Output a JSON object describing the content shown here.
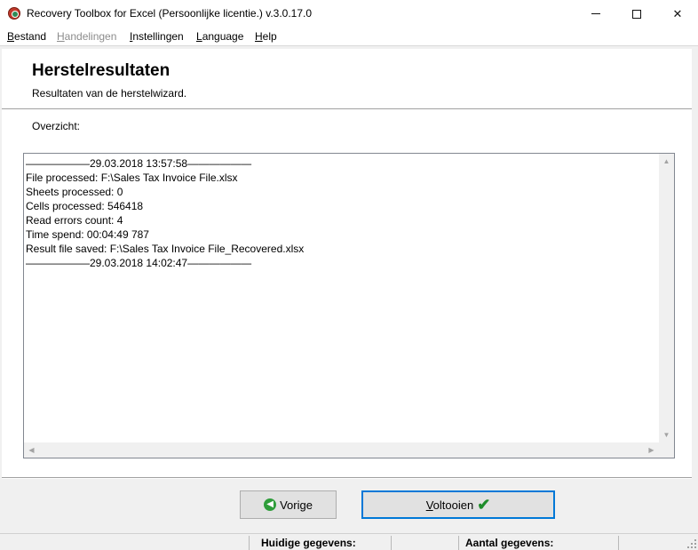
{
  "window": {
    "title": "Recovery Toolbox for Excel (Persoonlijke licentie.) v.3.0.17.0",
    "minimize_icon": "minimize-icon",
    "maximize_icon": "maximize-icon",
    "close_icon": "close-icon",
    "close_glyph": "✕"
  },
  "menu": {
    "items": [
      {
        "mnemonic": "B",
        "rest": "estand",
        "enabled": true
      },
      {
        "mnemonic": "H",
        "rest": "andelingen",
        "enabled": false
      },
      {
        "mnemonic": "I",
        "rest": "nstellingen",
        "enabled": true
      },
      {
        "mnemonic": "L",
        "rest": "anguage",
        "enabled": true
      },
      {
        "mnemonic": "H",
        "rest": "elp",
        "enabled": true
      }
    ]
  },
  "header": {
    "title": "Herstelresultaten",
    "subtitle": "Resultaten van de herstelwizard."
  },
  "main": {
    "overview_label": "Overzicht:",
    "log_lines": [
      "——————29.03.2018 13:57:58——————",
      "File processed: F:\\Sales Tax Invoice File.xlsx",
      "Sheets processed: 0",
      "Cells processed: 546418",
      "Read errors count: 4",
      "Time spend: 00:04:49 787",
      "Result file saved: F:\\Sales Tax Invoice File_Recovered.xlsx",
      "——————29.03.2018 14:02:47——————"
    ],
    "scroll_glyphs": {
      "up": "▲",
      "down": "▼",
      "left": "◀",
      "right": "▶"
    }
  },
  "footer": {
    "prev_label": "Vorige",
    "prev_icon": "arrow-left-circle-icon",
    "prev_glyph": "◀",
    "finish_mnemonic": "V",
    "finish_rest": "oltooien",
    "finish_icon": "checkmark-icon",
    "finish_glyph": "✔"
  },
  "status": {
    "current_label": "Huidige gegevens:",
    "count_label": "Aantal gegevens:"
  },
  "colors": {
    "accent": "#0078d7",
    "app_bg": "#f0f0f0",
    "green": "#2e9d3a"
  }
}
